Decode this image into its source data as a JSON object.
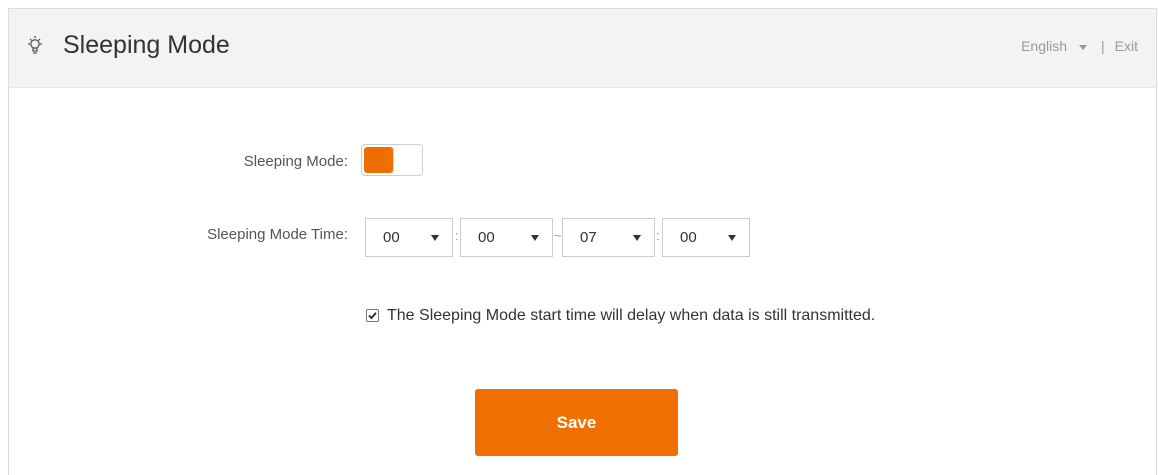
{
  "header": {
    "title": "Sleeping Mode",
    "icon": "lightbulb-icon",
    "language": "English",
    "separator": "|",
    "exit_label": "Exit"
  },
  "form": {
    "mode_label": "Sleeping Mode:",
    "mode_enabled": true,
    "time_label": "Sleeping Mode Time:",
    "start_hour": "00",
    "start_minute": "00",
    "end_hour": "07",
    "end_minute": "00",
    "colon": ":",
    "range_separator": "~",
    "delay_checked": true,
    "delay_text": "The Sleeping Mode start time will delay when data is still transmitted."
  },
  "actions": {
    "save_label": "Save"
  },
  "colors": {
    "accent": "#ef6f00",
    "header_bg": "#f3f3f3"
  }
}
